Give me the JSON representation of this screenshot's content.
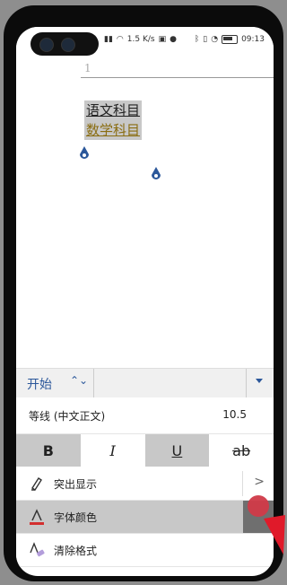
{
  "status": {
    "left": [
      "1.5 K/s"
    ],
    "right_time": "09:13"
  },
  "document": {
    "page_number": "1",
    "line1": "语文科目",
    "line2": "数学科目"
  },
  "toolbar": {
    "tab_label": "开始",
    "updown_icon": "⌃⌄",
    "dropdown_icon": "chevron-down"
  },
  "font": {
    "name": "等线 (中文正文)",
    "size": "10.5"
  },
  "format_buttons": {
    "bold": "B",
    "italic": "I",
    "underline": "U",
    "strikethrough": "ab"
  },
  "menu": {
    "highlight": {
      "label": "突出显示",
      "chevron": ">"
    },
    "font_color": {
      "label": "字体颜色",
      "underline_color": "#d32f2f"
    },
    "clear_format": {
      "label": "清除格式"
    }
  },
  "colors": {
    "accent": "#2b579a",
    "selection": "#c8c8c8",
    "font_color_red": "#d32f2f",
    "line2_text": "#8a6d12"
  }
}
